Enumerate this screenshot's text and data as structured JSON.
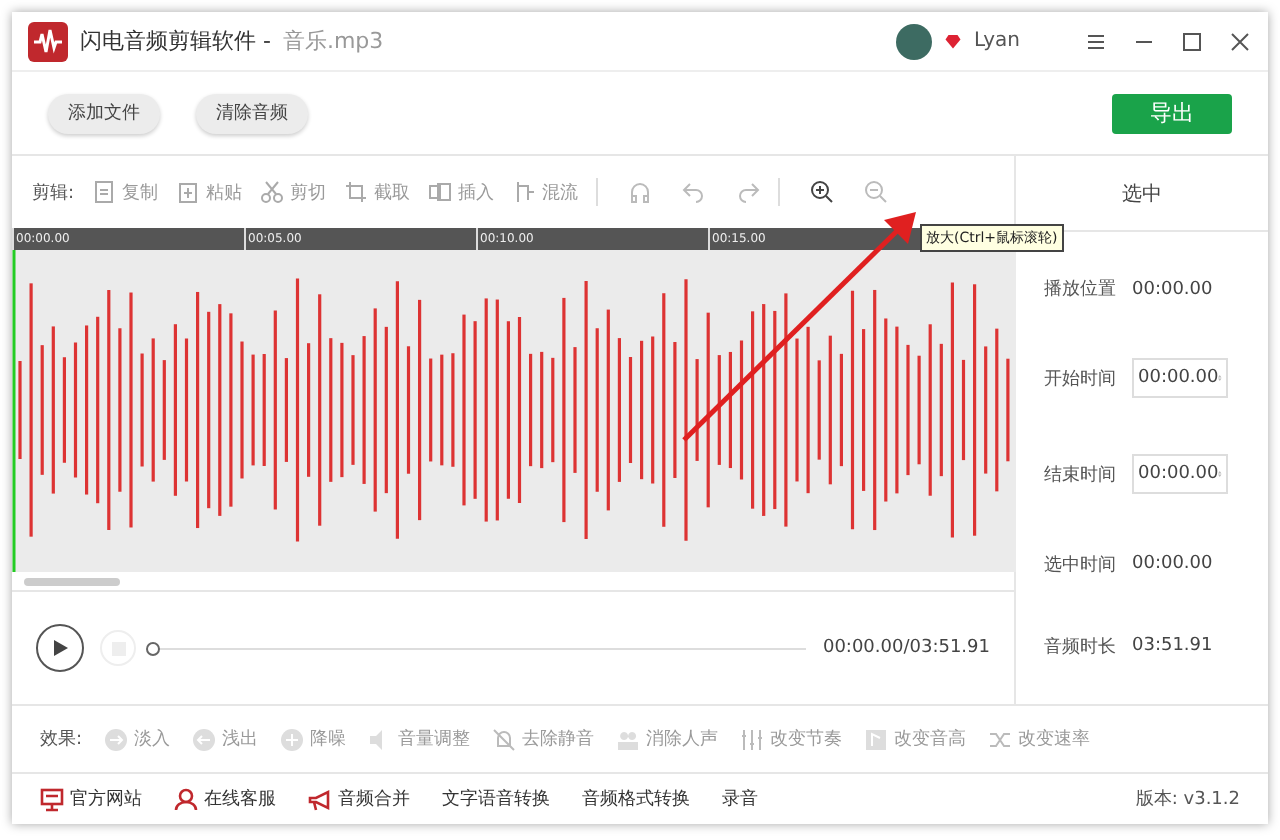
{
  "window": {
    "app_name": "闪电音频剪辑软件 - ",
    "file_name": "音乐.mp3",
    "user": "Lyan"
  },
  "top_buttons": [
    {
      "label": "添加文件"
    },
    {
      "label": "清除音频"
    }
  ],
  "export_button": "导出",
  "edit_bar": {
    "label": "剪辑:",
    "items": [
      {
        "label": "复制",
        "kind": "copy",
        "disabled": true
      },
      {
        "label": "粘贴",
        "kind": "paste",
        "disabled": true
      },
      {
        "label": "剪切",
        "kind": "cut",
        "disabled": true
      },
      {
        "label": "截取",
        "kind": "crop",
        "disabled": true
      },
      {
        "label": "插入",
        "kind": "insert",
        "disabled": true
      },
      {
        "label": "混流",
        "kind": "mix",
        "disabled": true
      }
    ],
    "tools": [
      {
        "kind": "headphones",
        "disabled": true
      },
      {
        "kind": "undo",
        "disabled": true
      },
      {
        "kind": "redo",
        "disabled": true
      },
      {
        "kind": "zoom-in",
        "disabled": false
      },
      {
        "kind": "zoom-out",
        "disabled": true
      }
    ]
  },
  "ruler": [
    "00:00.00",
    "00:05.00",
    "00:10.00",
    "00:15.00"
  ],
  "tooltip": "放大(Ctrl+鼠标滚轮)",
  "player": {
    "playing": false,
    "level": 0,
    "time": "00:00.00/03:51.91"
  },
  "side_panel": {
    "title": "选中",
    "rows": [
      {
        "label": "播放位置",
        "value": "00:00.00",
        "kind": "text"
      },
      {
        "label": "开始时间",
        "value": "00:00.00",
        "kind": "spin"
      },
      {
        "label": "结束时间",
        "value": "00:00.00",
        "kind": "spin"
      },
      {
        "label": "选中时间",
        "value": "00:00.00",
        "kind": "text"
      },
      {
        "label": "音频时长",
        "value": "03:51.91",
        "kind": "text"
      }
    ]
  },
  "effects": {
    "label": "效果:",
    "items": [
      {
        "label": "淡入",
        "kind": "fade-in",
        "disabled": true
      },
      {
        "label": "浅出",
        "kind": "fade-out",
        "disabled": true
      },
      {
        "label": "降噪",
        "kind": "denoise",
        "disabled": true
      },
      {
        "label": "音量调整",
        "kind": "volume",
        "disabled": true
      },
      {
        "label": "去除静音",
        "kind": "mute",
        "disabled": true
      },
      {
        "label": "消除人声",
        "kind": "people",
        "disabled": true
      },
      {
        "label": "改变节奏",
        "kind": "sliders",
        "disabled": true
      },
      {
        "label": "改变音高",
        "kind": "pitch",
        "disabled": true
      },
      {
        "label": "改变速率",
        "kind": "shuffle",
        "disabled": true
      }
    ]
  },
  "footer": {
    "links": [
      {
        "label": "官方网站",
        "kind": "monitor"
      },
      {
        "label": "在线客服",
        "kind": "person"
      },
      {
        "label": "音频合并",
        "kind": "megaphone"
      },
      {
        "label": "文字语音转换",
        "kind": "none"
      },
      {
        "label": "音频格式转换",
        "kind": "none"
      },
      {
        "label": "录音",
        "kind": "none"
      }
    ],
    "version": "版本: v3.1.2"
  }
}
